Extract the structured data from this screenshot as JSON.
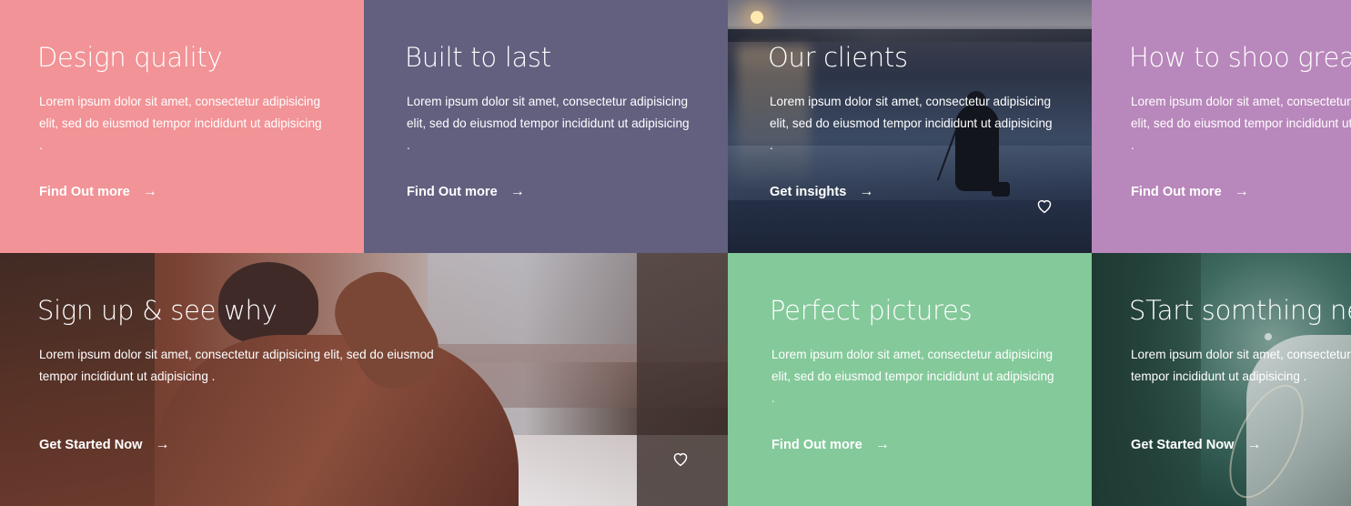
{
  "colors": {
    "pink": "#f29397",
    "slate": "#625f7f",
    "purple": "#b887bb",
    "green": "#84c99a"
  },
  "tiles": [
    {
      "title": "Design quality",
      "description": "Lorem ipsum dolor sit amet, consectetur adipisicing elit, sed do eiusmod tempor incididunt ut adipisicing .",
      "cta": "Find Out more",
      "arrow": "→"
    },
    {
      "title": "Built to last",
      "description": "Lorem ipsum dolor sit amet, consectetur adipisicing elit, sed do eiusmod tempor incididunt ut adipisicing .",
      "cta": "Find Out more",
      "arrow": "→"
    },
    {
      "title": "Our clients",
      "description": "Lorem ipsum dolor sit amet, consectetur adipisicing elit, sed do eiusmod tempor incididunt ut adipisicing .",
      "cta": "Get insights",
      "arrow": "→",
      "icon": "heart-icon"
    },
    {
      "title": "How to shoo great",
      "description": "Lorem ipsum dolor sit amet, consectetur adipisicing elit, sed do eiusmod tempor incididunt ut adipisicing .",
      "cta": "Find Out more",
      "arrow": "→"
    },
    {
      "title": "Sign up & see why",
      "description": "Lorem ipsum dolor sit amet, consectetur adipisicing elit, sed do eiusmod tempor incididunt ut adipisicing .",
      "cta": "Get Started Now",
      "arrow": "→",
      "icon": "heart-icon"
    },
    {
      "title": "Perfect pictures",
      "description": "Lorem ipsum dolor sit amet, consectetur adipisicing elit, sed do eiusmod tempor incididunt ut adipisicing .",
      "cta": "Find Out more",
      "arrow": "→"
    },
    {
      "title": "STart somthing new",
      "description": "Lorem ipsum dolor sit amet, consectetur adipisicing elit, sed do eiusmod tempor incididunt ut adipisicing .",
      "cta": "Get Started Now",
      "arrow": "→"
    }
  ]
}
